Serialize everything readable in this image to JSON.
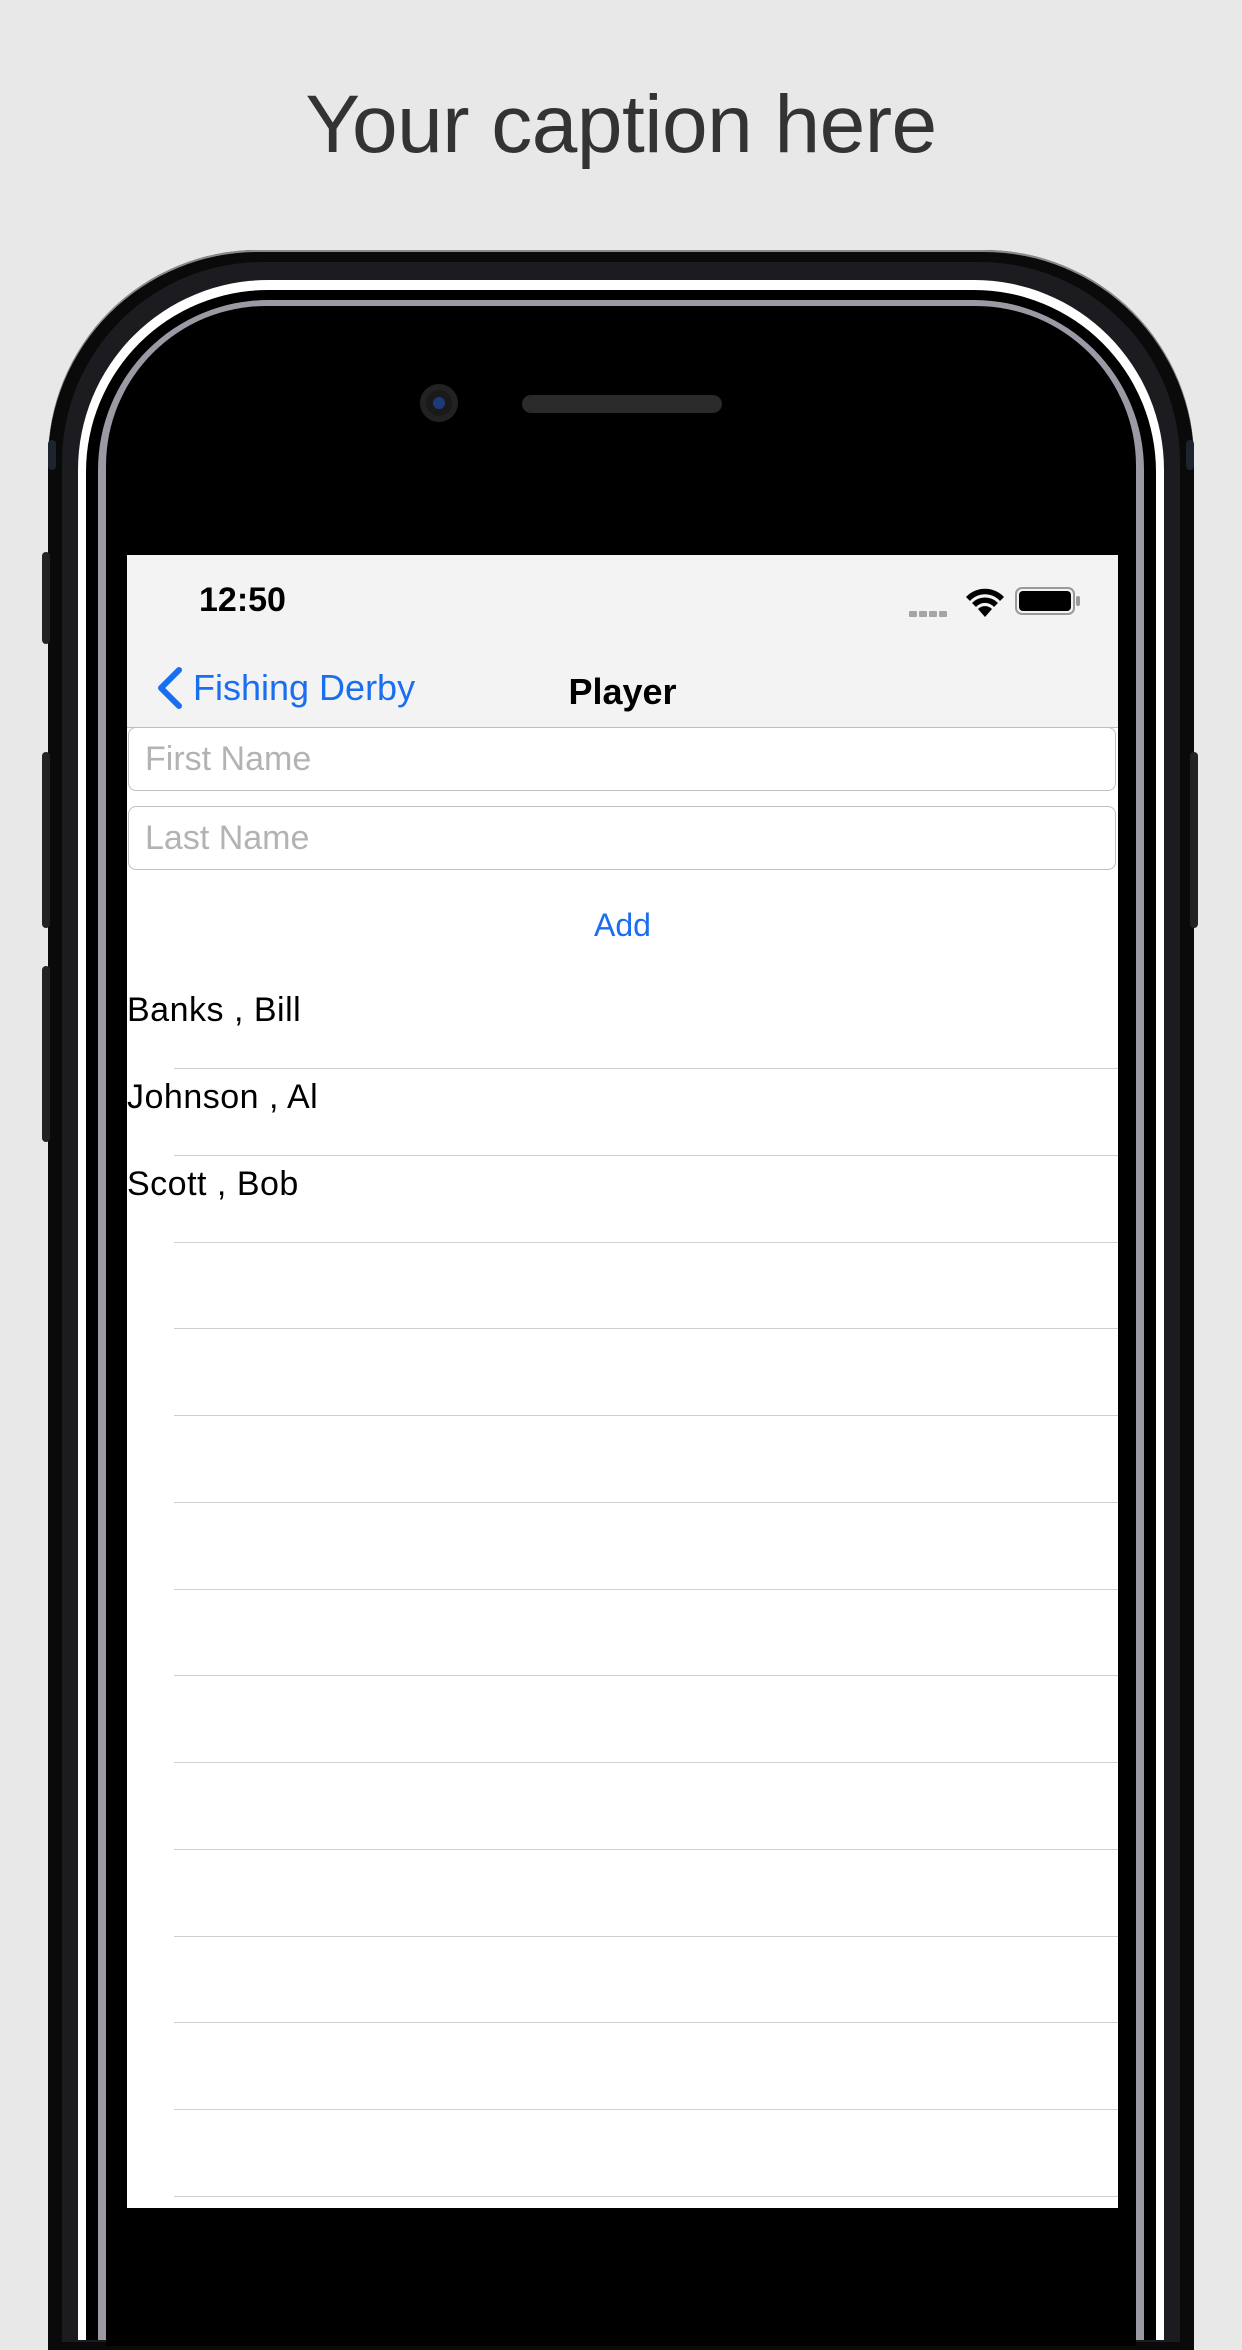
{
  "caption": "Your caption here",
  "status_bar": {
    "time": "12:50",
    "icons": [
      "signal-icon",
      "wifi-icon",
      "battery-icon"
    ]
  },
  "nav": {
    "back_label": "Fishing Derby",
    "title": "Player"
  },
  "form": {
    "first_name": {
      "value": "",
      "placeholder": "First Name"
    },
    "last_name": {
      "value": "",
      "placeholder": "Last Name"
    },
    "add_label": "Add"
  },
  "players": [
    {
      "label": "Banks ,  Bill"
    },
    {
      "label": "Johnson ,  Al"
    },
    {
      "label": "Scott ,  Bob"
    }
  ],
  "colors": {
    "accent": "#1a6ef0",
    "background": "#e8e8e8",
    "bar": "#f4f3f4"
  }
}
